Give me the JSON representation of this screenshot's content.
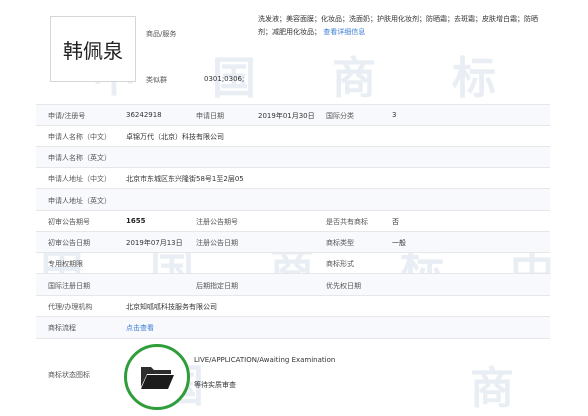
{
  "logo_text": "韩佩泉",
  "header": {
    "goods_label": "商品/服务",
    "goods_text": "洗发液；美容面膜；化妆品；洗面奶；护肤用化妆剂；防晒霜；去斑霜；皮肤增白霜；防晒剂；减肥用化妆品；",
    "goods_link": "查看详细信息",
    "similar_group_label": "类似群",
    "similar_group_value": "0301;0306;"
  },
  "fields": {
    "reg_no_label": "申请/注册号",
    "reg_no_value": "36242918",
    "apply_date_label": "申请日期",
    "apply_date_value": "2019年01月30日",
    "intl_class_label": "国际分类",
    "intl_class_value": "3",
    "applicant_cn_label": "申请人名称（中文）",
    "applicant_cn_value": "卓锦万代（北京）科技有限公司",
    "applicant_en_label": "申请人名称（英文）",
    "address_cn_label": "申请人地址（中文）",
    "address_cn_value": "北京市东城区东兴隆街58号1至2层05",
    "address_en_label": "申请人地址（英文）",
    "prelim_no_label": "初审公告期号",
    "prelim_no_value": "1655",
    "reg_pub_no_label": "注册公告期号",
    "shared_label": "是否共有商标",
    "shared_value": "否",
    "prelim_date_label": "初审公告日期",
    "prelim_date_value": "2019年07月13日",
    "reg_pub_date_label": "注册公告日期",
    "tm_type_label": "商标类型",
    "tm_type_value": "一般",
    "exclusive_label": "专用权期限",
    "tm_form_label": "商标形式",
    "intl_reg_date_label": "国际注册日期",
    "later_designation_label": "后期指定日期",
    "priority_date_label": "优先权日期",
    "agent_label": "代理/办理机构",
    "agent_value": "北京知呱呱科技服务有限公司",
    "process_label": "商标流程",
    "process_link": "点击查看",
    "status_icon_label": "商标状态图标",
    "status_en": "LIVE/APPLICATION/Awaiting Examination",
    "status_cn": "等待实质审查"
  },
  "watermark": [
    "中",
    "国",
    "商",
    "标",
    "中",
    "国",
    "商",
    "标",
    "中",
    "国",
    "商"
  ]
}
